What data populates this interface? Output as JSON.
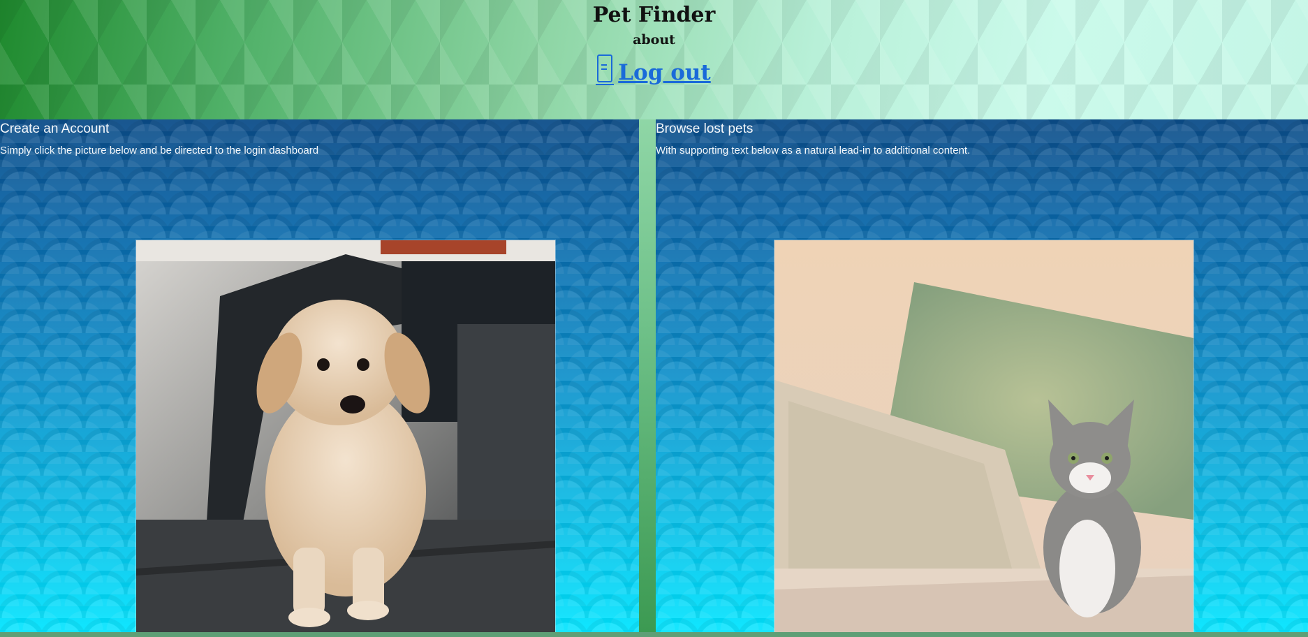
{
  "header": {
    "title": "Pet Finder",
    "about": "about",
    "logout_label": "Log out"
  },
  "cards": [
    {
      "title": "Create an Account",
      "text": "Simply click the picture below and be directed to the login dashboard",
      "image": "puppy-photo"
    },
    {
      "title": "Browse lost pets",
      "text": "With supporting text below as a natural lead-in to additional content.",
      "image": "kitten-photo"
    }
  ],
  "icons": {
    "logout": "logout-icon"
  },
  "colors": {
    "link": "#1a6ad9",
    "panel_top": "#0b4c88",
    "panel_bottom": "#00e4ff",
    "header_left": "#1f8a2e",
    "header_right": "#c4f6e6"
  }
}
